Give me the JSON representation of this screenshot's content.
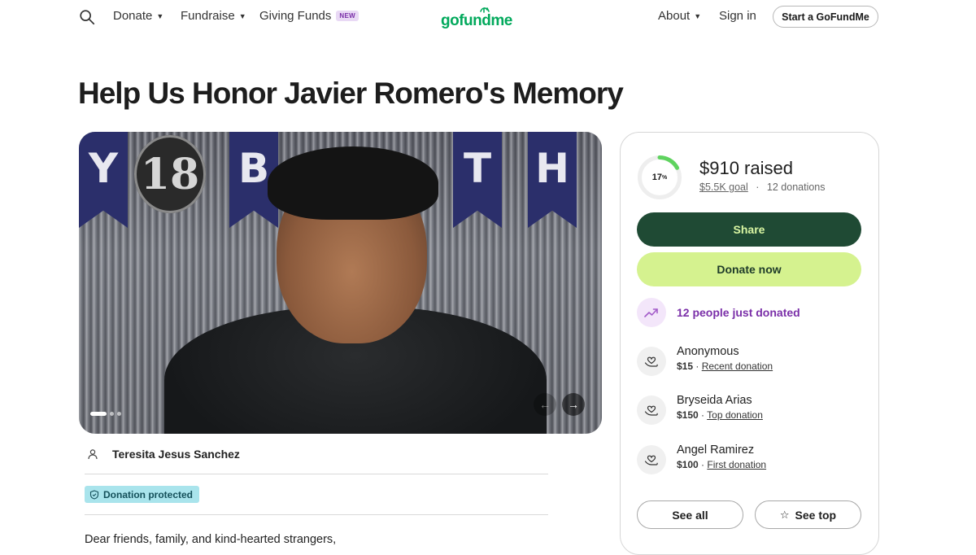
{
  "header": {
    "nav_left": [
      "Donate",
      "Fundraise",
      "Giving Funds"
    ],
    "new_badge": "NEW",
    "logo_text": "gofundme",
    "nav_right": [
      "About",
      "Sign in"
    ],
    "cta": "Start a GoFundMe",
    "icons": {
      "search": "search-icon",
      "caret": "chevron-down-icon"
    }
  },
  "campaign": {
    "title": "Help Us Honor Javier Romero's Memory",
    "hero": {
      "banner_letters": [
        "Y",
        "B",
        "T",
        "H"
      ],
      "balloon_text": "18",
      "slide_count": 3,
      "active_slide": 1
    },
    "organizer": "Teresita Jesus Sanchez",
    "protected_label": "Donation protected",
    "story_intro": "Dear friends, family, and kind-hearted strangers,"
  },
  "donation": {
    "percent": "17",
    "percent_symbol": "%",
    "progress_fraction": 0.17,
    "raised": "$910 raised",
    "goal": "$5.5K goal",
    "separator": "·",
    "count": "12 donations",
    "share_label": "Share",
    "donate_label": "Donate now",
    "recent_activity": "12 people just donated",
    "donors": [
      {
        "name": "Anonymous",
        "amount": "$15",
        "sep": " · ",
        "tag": "Recent donation"
      },
      {
        "name": "Bryseida Arias",
        "amount": "$150",
        "sep": " · ",
        "tag": "Top donation"
      },
      {
        "name": "Angel Ramirez",
        "amount": "$100",
        "sep": " · ",
        "tag": "First donation"
      }
    ],
    "see_all": "See all",
    "see_top": "See top"
  },
  "colors": {
    "brand_green": "#02a95c",
    "share_bg": "#1f4a34",
    "donate_bg": "#d5f28f",
    "progress": "#5fd35f",
    "trend_purple": "#7a2fa8",
    "protected_bg": "#a9e4ec"
  }
}
